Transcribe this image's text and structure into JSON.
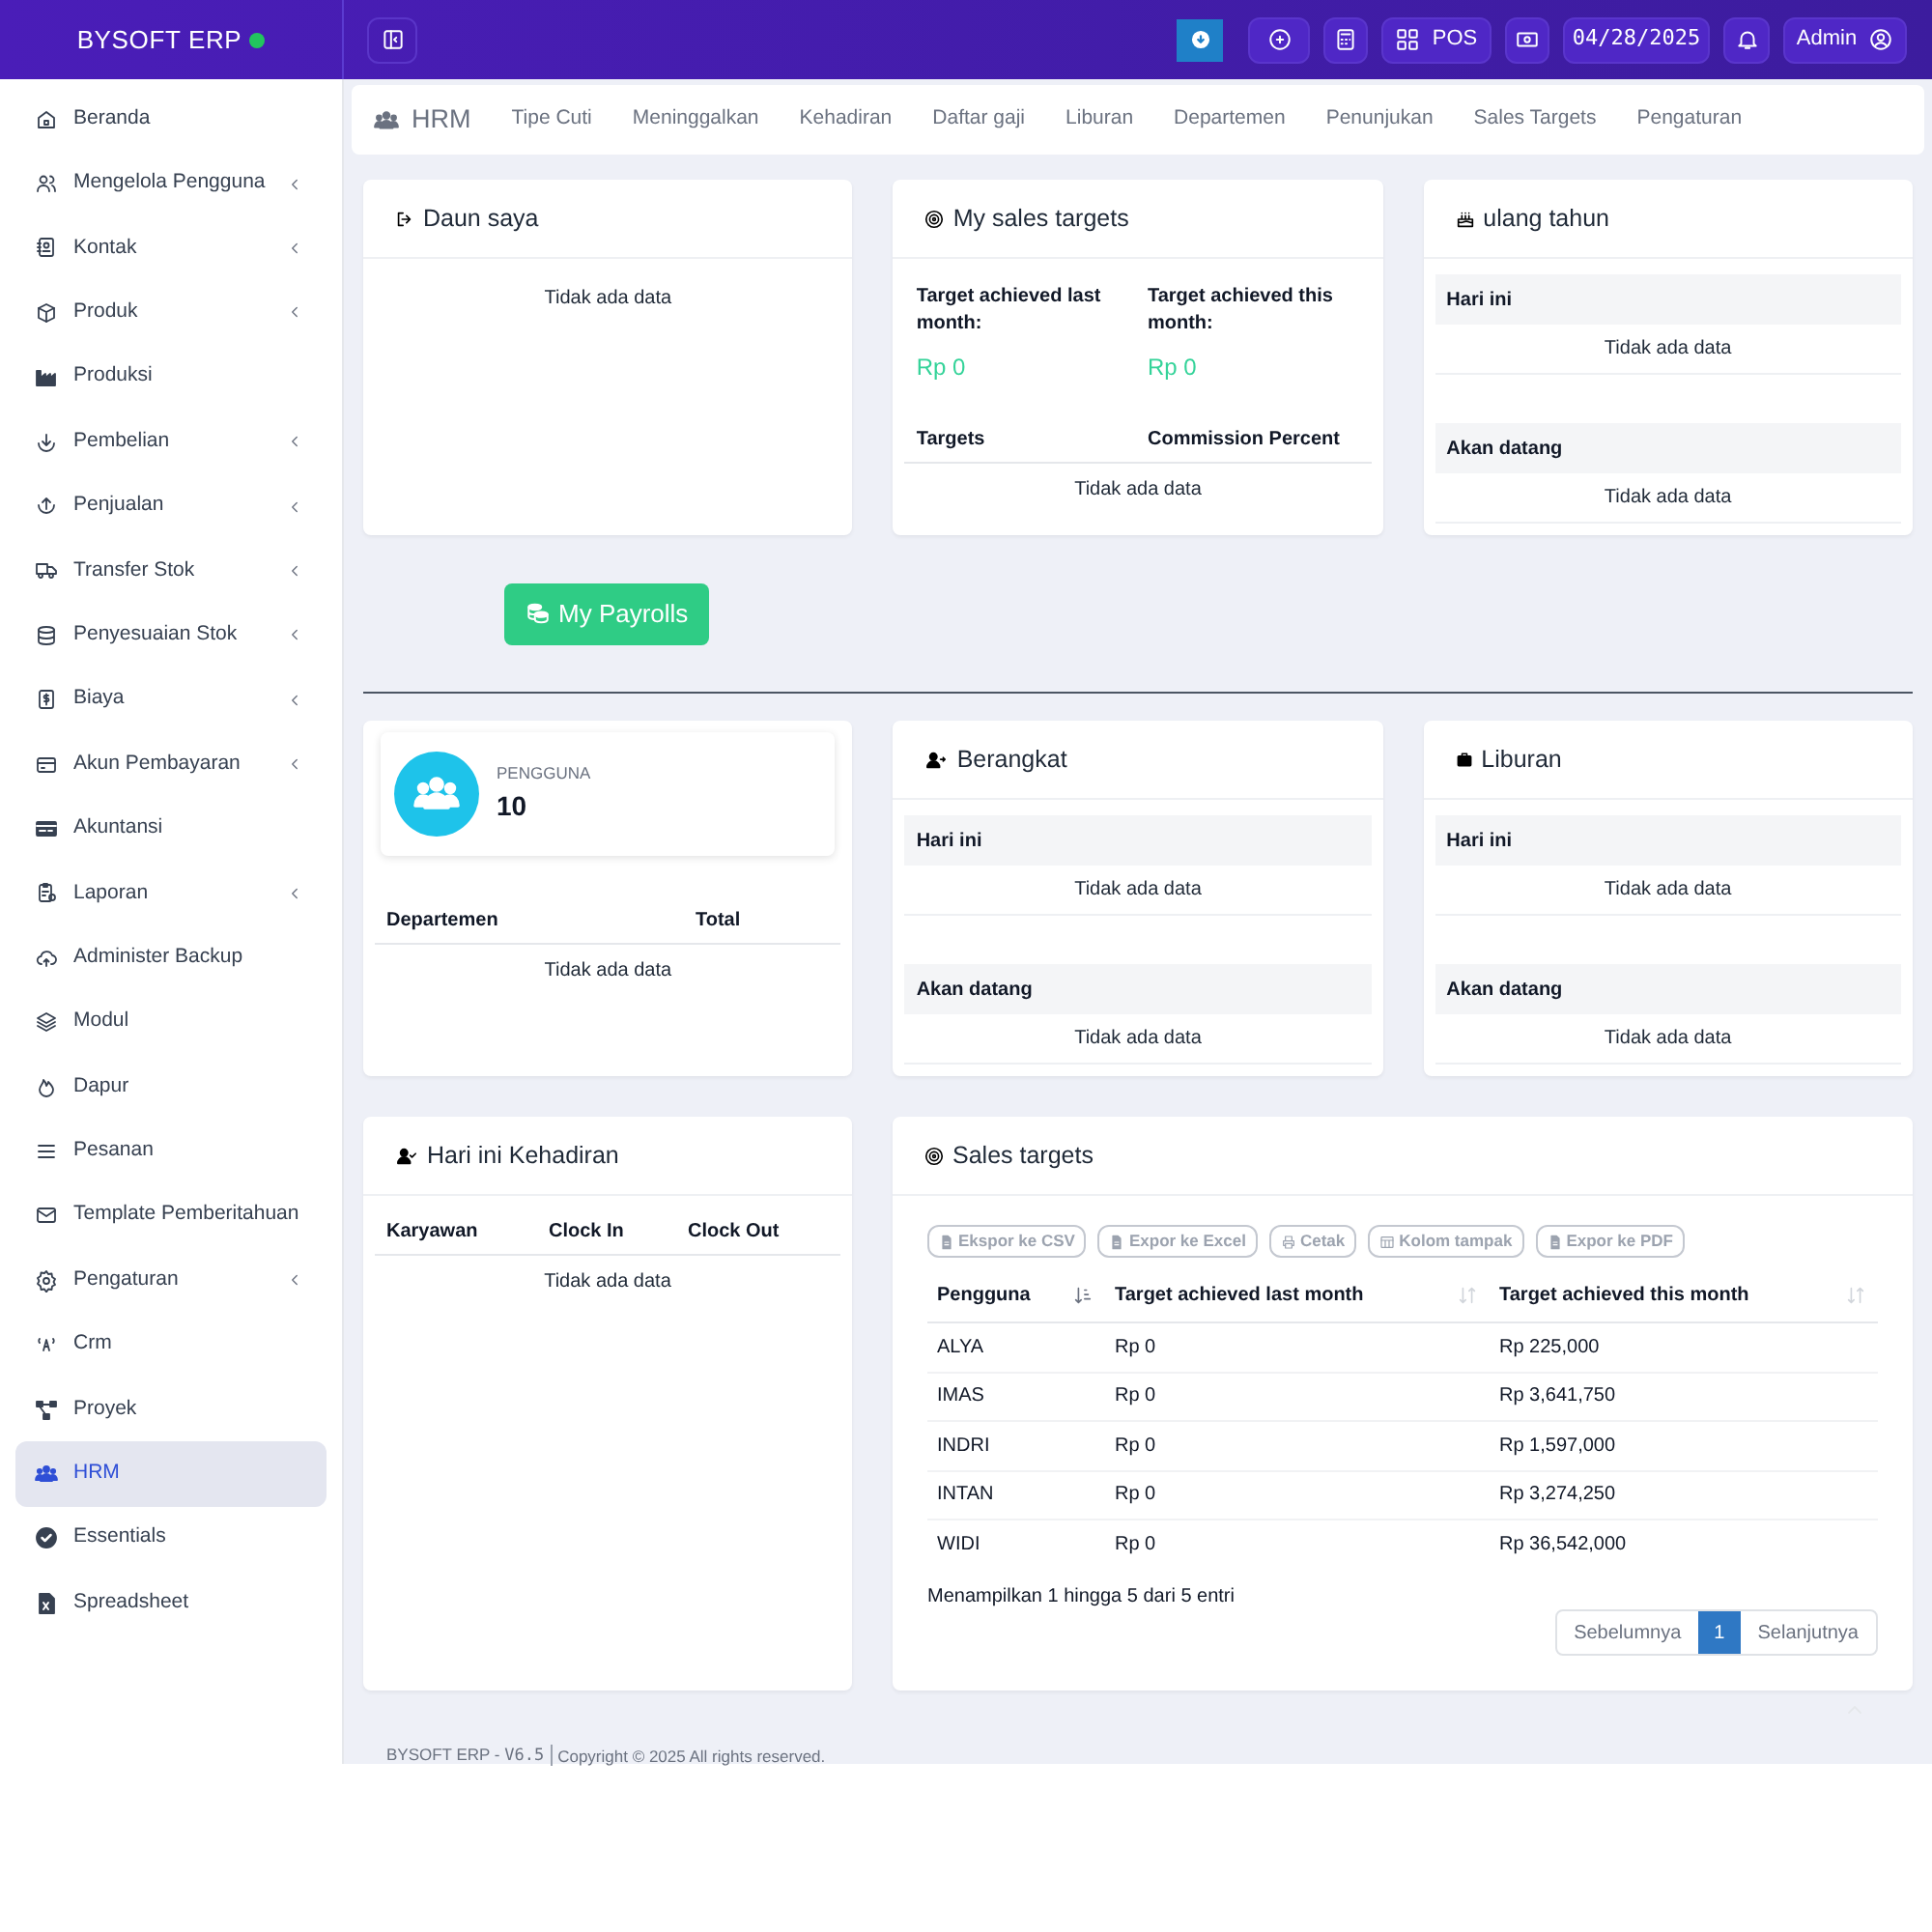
{
  "header": {
    "brand": "BYSOFT ERP",
    "pos_label": "POS",
    "date": "04/28/2025",
    "user": "Admin"
  },
  "sidebar": {
    "items": [
      {
        "label": "Beranda",
        "expandable": false,
        "selected": false
      },
      {
        "label": "Mengelola Pengguna",
        "expandable": true,
        "selected": false
      },
      {
        "label": "Kontak",
        "expandable": true,
        "selected": false
      },
      {
        "label": "Produk",
        "expandable": true,
        "selected": false
      },
      {
        "label": "Produksi",
        "expandable": false,
        "selected": false
      },
      {
        "label": "Pembelian",
        "expandable": true,
        "selected": false
      },
      {
        "label": "Penjualan",
        "expandable": true,
        "selected": false
      },
      {
        "label": "Transfer Stok",
        "expandable": true,
        "selected": false
      },
      {
        "label": "Penyesuaian Stok",
        "expandable": true,
        "selected": false
      },
      {
        "label": "Biaya",
        "expandable": true,
        "selected": false
      },
      {
        "label": "Akun Pembayaran",
        "expandable": true,
        "selected": false
      },
      {
        "label": "Akuntansi",
        "expandable": false,
        "selected": false
      },
      {
        "label": "Laporan",
        "expandable": true,
        "selected": false
      },
      {
        "label": "Administer Backup",
        "expandable": false,
        "selected": false
      },
      {
        "label": "Modul",
        "expandable": false,
        "selected": false
      },
      {
        "label": "Dapur",
        "expandable": false,
        "selected": false
      },
      {
        "label": "Pesanan",
        "expandable": false,
        "selected": false
      },
      {
        "label": "Template Pemberitahuan",
        "expandable": false,
        "selected": false
      },
      {
        "label": "Pengaturan",
        "expandable": true,
        "selected": false
      },
      {
        "label": "Crm",
        "expandable": false,
        "selected": false
      },
      {
        "label": "Proyek",
        "expandable": false,
        "selected": false
      },
      {
        "label": "HRM",
        "expandable": false,
        "selected": true
      },
      {
        "label": "Essentials",
        "expandable": false,
        "selected": false
      },
      {
        "label": "Spreadsheet",
        "expandable": false,
        "selected": false
      }
    ]
  },
  "module_nav": {
    "title": "HRM",
    "tabs": [
      {
        "label": "Tipe Cuti",
        "selected": false
      },
      {
        "label": "Meninggalkan",
        "selected": false
      },
      {
        "label": "Kehadiran",
        "selected": false
      },
      {
        "label": "Daftar gaji",
        "selected": false
      },
      {
        "label": "Liburan",
        "selected": false
      },
      {
        "label": "Departemen",
        "selected": false
      },
      {
        "label": "Penunjukan",
        "selected": false
      },
      {
        "label": "Sales Targets",
        "selected": false
      },
      {
        "label": "Pengaturan",
        "selected": false
      }
    ]
  },
  "my_leaves": {
    "title": "Daun saya",
    "empty": "Tidak ada data"
  },
  "my_sales_targets": {
    "title": "My sales targets",
    "last_month_label": "Target achieved last month:",
    "last_month_value": "Rp 0",
    "this_month_label": "Target achieved this month:",
    "this_month_value": "Rp 0",
    "columns": [
      "Targets",
      "Commission Percent"
    ],
    "empty": "Tidak ada data"
  },
  "birthdays": {
    "title": "ulang tahun",
    "sections": [
      {
        "heading": "Hari ini",
        "empty": "Tidak ada data"
      },
      {
        "heading": "Akan datang",
        "empty": "Tidak ada data"
      }
    ]
  },
  "payrolls_button": "My Payrolls",
  "users_card": {
    "stat_label": "PENGGUNA",
    "stat_value": "10",
    "columns": [
      "Departemen",
      "Total"
    ],
    "empty": "Tidak ada data"
  },
  "departing": {
    "title": "Berangkat",
    "sections": [
      {
        "heading": "Hari ini",
        "empty": "Tidak ada data"
      },
      {
        "heading": "Akan datang",
        "empty": "Tidak ada data"
      }
    ]
  },
  "holidays": {
    "title": "Liburan",
    "sections": [
      {
        "heading": "Hari ini",
        "empty": "Tidak ada data"
      },
      {
        "heading": "Akan datang",
        "empty": "Tidak ada data"
      }
    ]
  },
  "attendance": {
    "title": "Hari ini Kehadiran",
    "columns": [
      "Karyawan",
      "Clock In",
      "Clock Out"
    ],
    "empty": "Tidak ada data"
  },
  "sales_targets": {
    "title": "Sales targets",
    "export_buttons": [
      {
        "label": "Ekspor ke CSV",
        "kind": "file"
      },
      {
        "label": "Expor ke Excel",
        "kind": "file"
      },
      {
        "label": "Cetak",
        "kind": "print"
      },
      {
        "label": "Kolom tampak",
        "kind": "columns"
      },
      {
        "label": "Expor ke PDF",
        "kind": "file"
      }
    ],
    "columns": [
      {
        "label": "Pengguna",
        "sorted": true
      },
      {
        "label": "Target achieved last month",
        "sorted": false
      },
      {
        "label": "Target achieved this month",
        "sorted": false
      }
    ],
    "rows": [
      [
        "ALYA",
        "Rp 0",
        "Rp 225,000"
      ],
      [
        "IMAS",
        "Rp 0",
        "Rp 3,641,750"
      ],
      [
        "INDRI",
        "Rp 0",
        "Rp 1,597,000"
      ],
      [
        "INTAN",
        "Rp 0",
        "Rp 3,274,250"
      ],
      [
        "WIDI",
        "Rp 0",
        "Rp 36,542,000"
      ]
    ],
    "info": "Menampilkan 1 hingga 5 dari 5 entri",
    "pagination": {
      "previous": "Sebelumnya",
      "pages": [
        {
          "label": "1",
          "selected": true
        }
      ],
      "next": "Selanjutnya"
    }
  },
  "footer": {
    "brand": "BYSOFT ERP - ",
    "version": "V6.5",
    "copyright": "Copyright © 2025 All rights reserved."
  }
}
